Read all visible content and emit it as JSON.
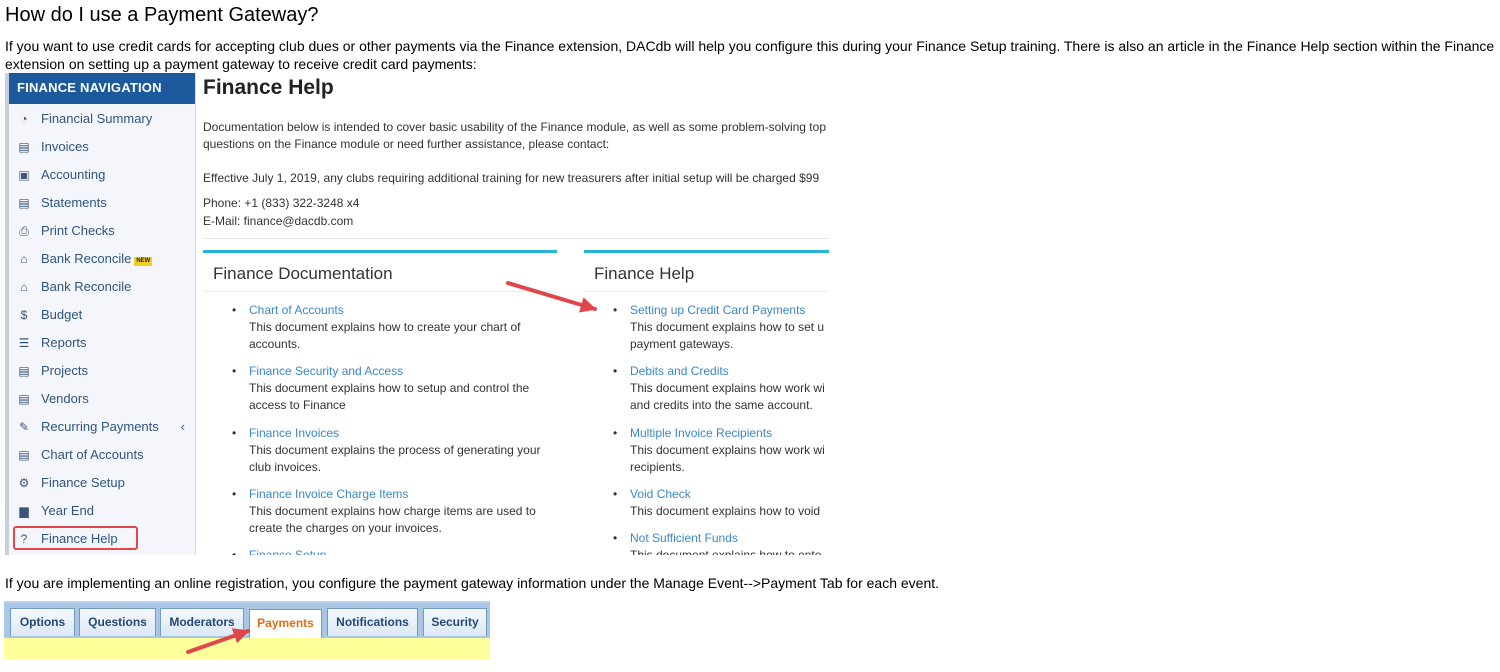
{
  "article": {
    "heading": "How do I use a Payment Gateway?",
    "intro": "If you want to use credit cards for accepting club dues or other payments via the Finance extension, DACdb will help you configure this during your Finance Setup training. There is also an article in the Finance Help section within the Finance extension on setting up a payment gateway to receive credit card payments:",
    "outro": "If you are implementing an online registration, you configure the payment gateway information under the Manage Event-->Payment Tab for each event."
  },
  "finance_nav": {
    "header": "FINANCE NAVIGATION",
    "items": [
      {
        "label": "Financial Summary",
        "icon": "dashboard-icon",
        "glyph": "◔"
      },
      {
        "label": "Invoices",
        "icon": "document-icon",
        "glyph": "▤"
      },
      {
        "label": "Accounting",
        "icon": "money-icon",
        "glyph": "▣"
      },
      {
        "label": "Statements",
        "icon": "document-icon",
        "glyph": "▤"
      },
      {
        "label": "Print Checks",
        "icon": "printer-icon",
        "glyph": "⎙"
      },
      {
        "label": "Bank Reconcile",
        "icon": "bank-icon",
        "glyph": "⌂",
        "badge": "NEW"
      },
      {
        "label": "Bank Reconcile",
        "icon": "bank-icon",
        "glyph": "⌂"
      },
      {
        "label": "Budget",
        "icon": "dollar-icon",
        "glyph": "$"
      },
      {
        "label": "Reports",
        "icon": "list-icon",
        "glyph": "☰"
      },
      {
        "label": "Projects",
        "icon": "list-box-icon",
        "glyph": "▤"
      },
      {
        "label": "Vendors",
        "icon": "list-box-icon",
        "glyph": "▤"
      },
      {
        "label": "Recurring Payments",
        "icon": "wrench-icon",
        "glyph": "✎",
        "chevron": "‹"
      },
      {
        "label": "Chart of Accounts",
        "icon": "list-box-icon",
        "glyph": "▤"
      },
      {
        "label": "Finance Setup",
        "icon": "gear-icon",
        "glyph": "⚙"
      },
      {
        "label": "Year End",
        "icon": "calendar-icon",
        "glyph": "▆"
      },
      {
        "label": "Finance Help",
        "icon": "question-icon",
        "glyph": "?",
        "highlighted": true
      }
    ]
  },
  "finance_help": {
    "title": "Finance Help",
    "line1": "Documentation below is intended to cover basic usability of the Finance module, as well as some problem-solving top",
    "line2": "questions on the Finance module or need further assistance, please contact:",
    "line3": "Effective July 1, 2019, any clubs requiring additional training for new treasurers after initial setup will be charged $99",
    "phone": "Phone: +1 (833) 322-3248 x4",
    "email": "E-Mail: finance@dacdb.com"
  },
  "doc_panel": {
    "title": "Finance Documentation",
    "entries": [
      {
        "link": "Chart of Accounts",
        "desc1": "This document explains how to create your chart of",
        "desc2": "accounts."
      },
      {
        "link": "Finance Security and Access",
        "desc1": "This document explains how to setup and control the",
        "desc2": "access to Finance"
      },
      {
        "link": "Finance Invoices",
        "desc1": "This document explains the process of generating your",
        "desc2": "club invoices."
      },
      {
        "link": "Finance Invoice Charge Items",
        "desc1": "This document explains how charge items are used to",
        "desc2": "create the charges on your invoices."
      },
      {
        "link": "Finance Setup",
        "desc1": "",
        "desc2": ""
      }
    ]
  },
  "help_panel": {
    "title": "Finance Help",
    "entries": [
      {
        "link": "Setting up Credit Card Payments",
        "desc1": "This document explains how to set u",
        "desc2": "payment gateways."
      },
      {
        "link": "Debits and Credits",
        "desc1": "This document explains how work wi",
        "desc2": "and credits into the same account."
      },
      {
        "link": "Multiple Invoice Recipients",
        "desc1": "This document explains how work wi",
        "desc2": "recipients."
      },
      {
        "link": "Void Check",
        "desc1": "This document explains how to void",
        "desc2": ""
      },
      {
        "link": "Not Sufficient Funds",
        "desc1": "This document explains how to ente",
        "desc2": ""
      }
    ]
  },
  "event_tabs": {
    "tabs": [
      "Options",
      "Questions",
      "Moderators",
      "Payments",
      "Notifications",
      "Security"
    ],
    "active": "Payments"
  },
  "colors": {
    "arrow": "#e0474c",
    "nav_header": "#1c5a9c",
    "link": "#3a87c6",
    "panel_accent": "#24b5d9",
    "active_tab_text": "#e06f1b",
    "highlight_box": "#e0474c"
  }
}
